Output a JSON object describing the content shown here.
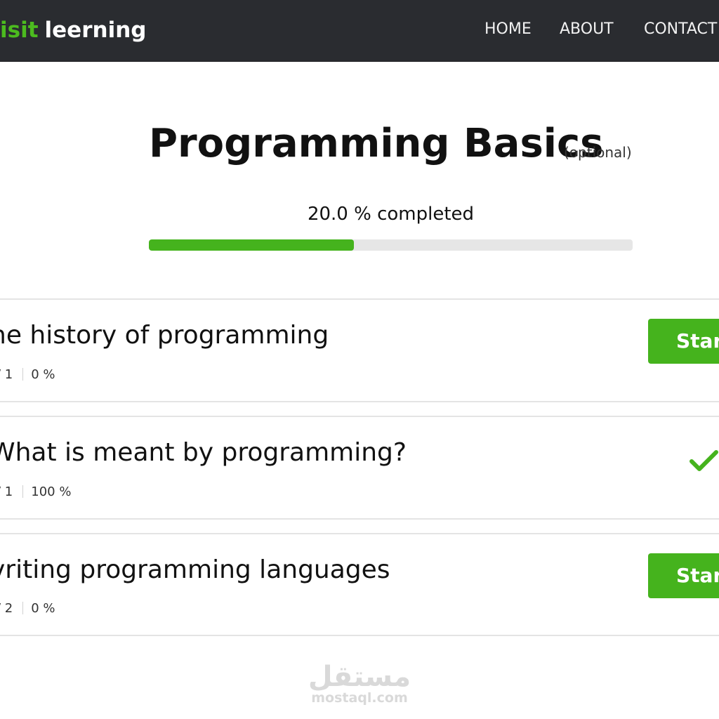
{
  "navbar": {
    "brand_accent": "isit",
    "brand_main": "leerning",
    "links": [
      "HOME",
      "ABOUT",
      "CONTACT"
    ]
  },
  "course": {
    "title": "Programming Basics",
    "optional_label": "(optional)",
    "progress_text": "20.0 % completed",
    "progress_fill_fraction": 0.424
  },
  "lessons": [
    {
      "title": "he history of programming",
      "count": "/ 1",
      "percent": "0 %",
      "action_label": "Start",
      "completed": false
    },
    {
      "title": "What is meant by programming?",
      "count": "/ 1",
      "percent": "100 %",
      "action_label": "",
      "completed": true
    },
    {
      "title": "vriting programming languages",
      "count": "/ 2",
      "percent": "0 %",
      "action_label": "Start",
      "completed": false
    }
  ],
  "watermark": {
    "arabic": "مستقل",
    "latin": "mostaql.com"
  },
  "colors": {
    "navbar_bg": "#2a2c30",
    "accent_green": "#45b31d",
    "brand_green": "#4cbb1f",
    "track_gray": "#e6e6e6"
  }
}
